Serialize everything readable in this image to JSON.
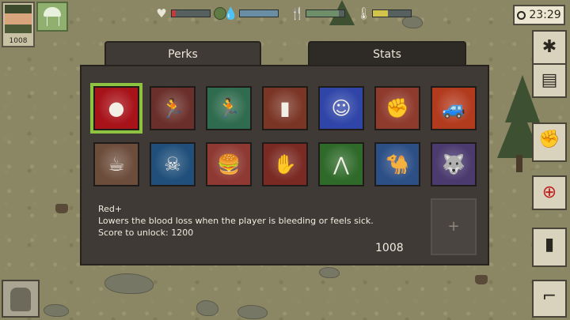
{
  "player": {
    "score": "1008"
  },
  "hud": {
    "health_icon": "heart-icon",
    "blood_icon": "blood-drop-icon",
    "hunger_icon": "fork-knife-icon",
    "temperature_icon": "thermometer-icon",
    "health_level": 0.1,
    "water_level": 1.0,
    "food_level": 0.85,
    "temperature_level": 0.4
  },
  "clock": {
    "time": "23:29"
  },
  "tabs": {
    "perks": "Perks",
    "stats": "Stats"
  },
  "perks": {
    "selected_index": 0,
    "items": [
      {
        "icon": "blood-cells-icon",
        "color": "#a8131a"
      },
      {
        "icon": "running-figures-icon",
        "color": "#6a2f2a"
      },
      {
        "icon": "sprinter-icon",
        "color": "#2f6b4e"
      },
      {
        "icon": "gravestone-icon",
        "color": "#7a3525"
      },
      {
        "icon": "figure-blue-aura-icon",
        "color": "#2f45a8"
      },
      {
        "icon": "fist-fighter-icon",
        "color": "#8e3a2c"
      },
      {
        "icon": "jeep-icon",
        "color": "#b23a1d"
      },
      {
        "icon": "coffee-cup-icon",
        "color": "#6c4c3a"
      },
      {
        "icon": "skull-icon",
        "color": "#1f4f7a"
      },
      {
        "icon": "burger-icon",
        "color": "#8e3a32"
      },
      {
        "icon": "zombie-hand-icon",
        "color": "#7a2a22"
      },
      {
        "icon": "grass-spikes-icon",
        "color": "#2f6a2a"
      },
      {
        "icon": "camel-icon",
        "color": "#2c4f86"
      },
      {
        "icon": "wolf-icon",
        "color": "#4a3a6e"
      }
    ]
  },
  "description": {
    "name": "Red+",
    "text": "Lowers the blood loss when the player is bleeding or feels sick.",
    "unlock": "Score to unlock:  1200"
  },
  "score_display": "1008",
  "slot": {
    "plus": "+"
  }
}
